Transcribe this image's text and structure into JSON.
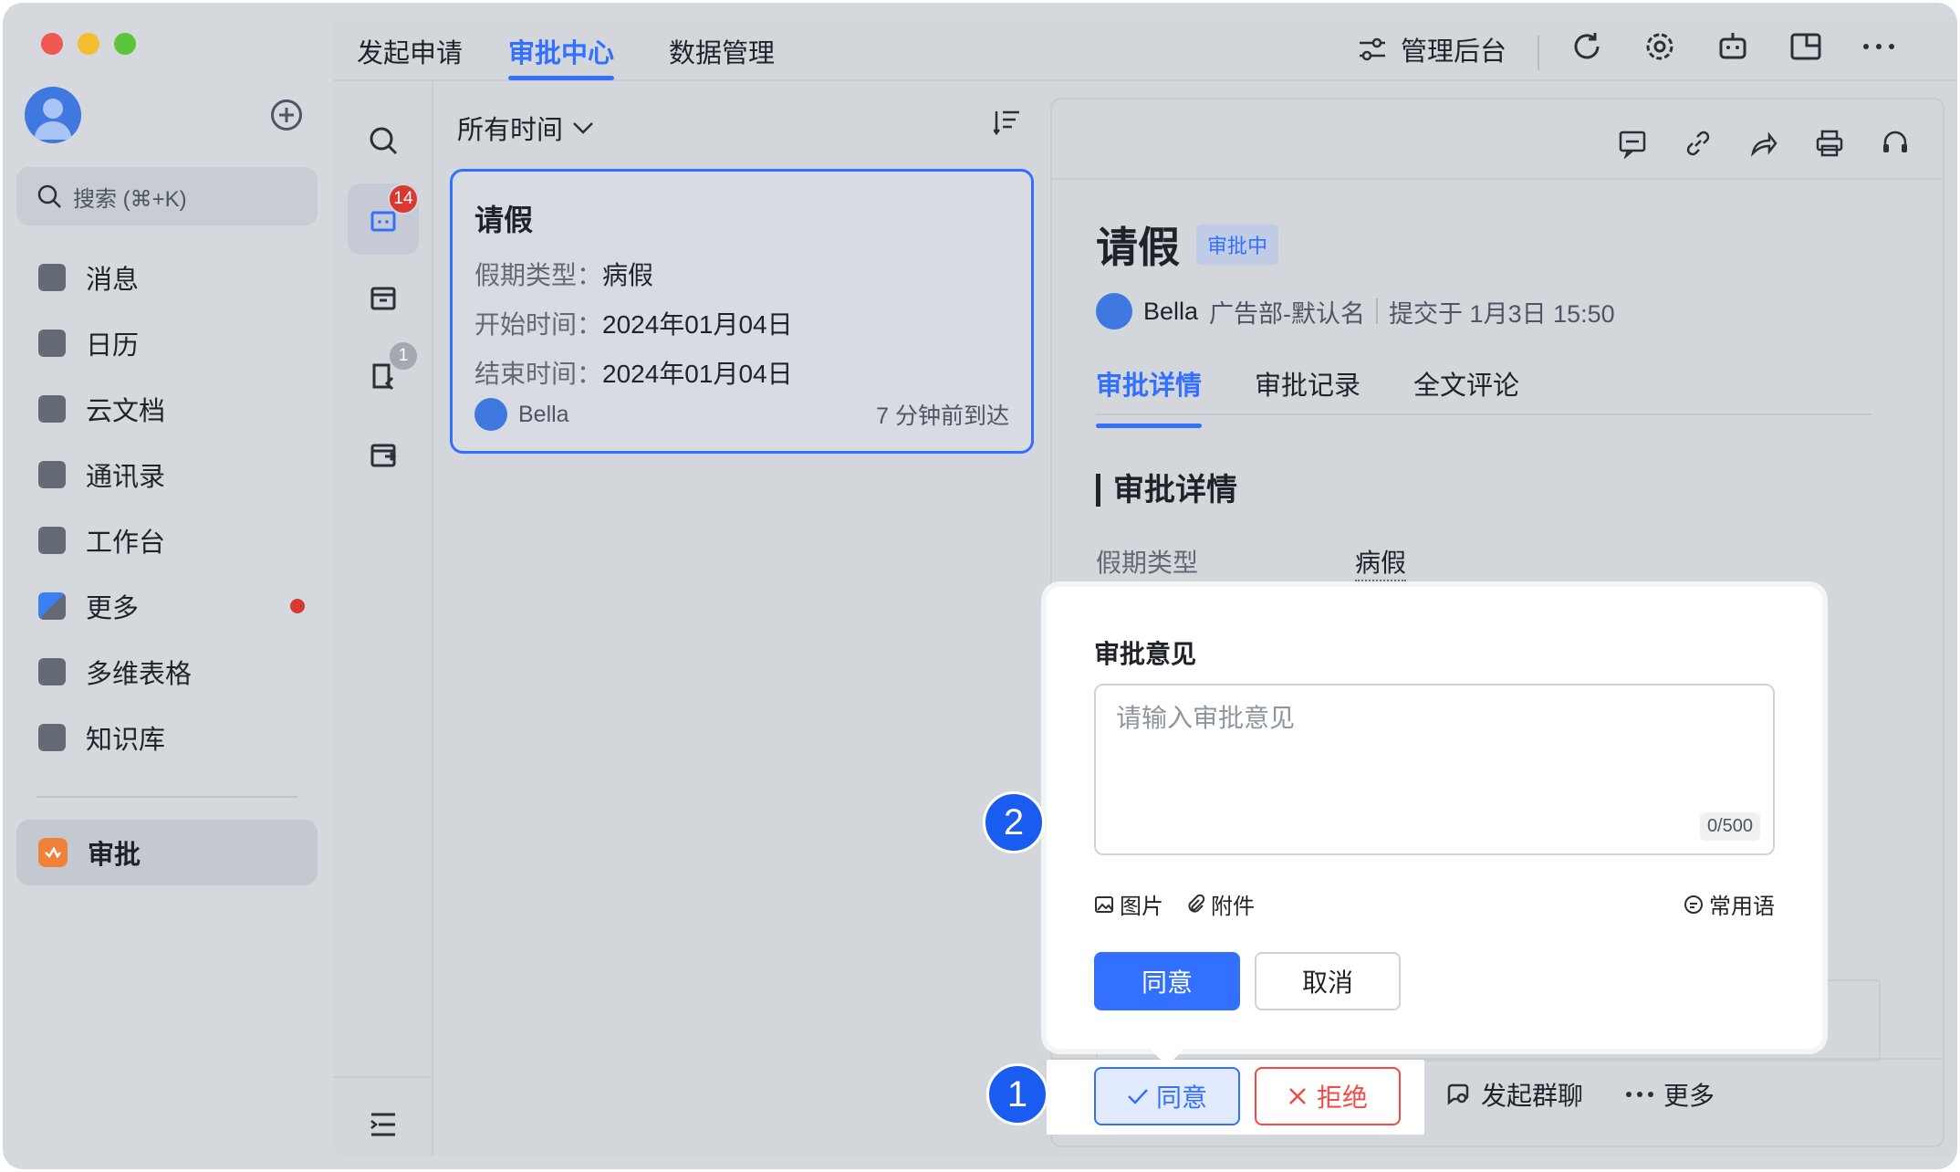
{
  "window": {
    "top_tabs": [
      "发起申请",
      "审批中心",
      "数据管理"
    ],
    "admin_label": "管理后台"
  },
  "sidebar": {
    "search_placeholder": "搜索 (⌘+K)",
    "items": [
      {
        "label": "消息",
        "icon": "chat-icon"
      },
      {
        "label": "日历",
        "icon": "calendar-icon"
      },
      {
        "label": "云文档",
        "icon": "docs-icon"
      },
      {
        "label": "通讯录",
        "icon": "contacts-icon"
      },
      {
        "label": "工作台",
        "icon": "workplace-icon"
      },
      {
        "label": "更多",
        "icon": "more-apps-icon"
      },
      {
        "label": "多维表格",
        "icon": "base-icon"
      },
      {
        "label": "知识库",
        "icon": "wiki-icon"
      }
    ],
    "active_item": {
      "label": "审批",
      "icon": "approval-icon"
    }
  },
  "icon_column": {
    "pending_badge": "14",
    "cc_badge": "1"
  },
  "list": {
    "filter_label": "所有时间",
    "card": {
      "title": "请假",
      "rows": [
        {
          "label": "假期类型：",
          "value": "病假"
        },
        {
          "label": "开始时间：",
          "value": "2024年01月04日"
        },
        {
          "label": "结束时间：",
          "value": "2024年01月04日"
        }
      ],
      "applicant": "Bella",
      "arrived": "7 分钟前到达"
    }
  },
  "detail": {
    "title": "请假",
    "status": "审批中",
    "applicant": "Bella",
    "department": "广告部-默认名",
    "submitted": "提交于  1月3日 15:50",
    "tabs": [
      "审批详情",
      "审批记录",
      "全文评论"
    ],
    "section_title": "审批详情",
    "field_label": "假期类型",
    "field_value": "病假"
  },
  "popover": {
    "title": "审批意见",
    "placeholder": "请输入审批意见",
    "counter": "0/500",
    "image_label": "图片",
    "attach_label": "附件",
    "phrase_label": "常用语",
    "agree_label": "同意",
    "cancel_label": "取消"
  },
  "actions": {
    "agree_label": "同意",
    "reject_label": "拒绝",
    "group_chat_label": "发起群聊",
    "more_label": "更多"
  },
  "steps": [
    "1",
    "2"
  ],
  "colors": {
    "accent": "#3370ff",
    "danger": "#f54a45",
    "step_marker": "#1a5cf0"
  }
}
